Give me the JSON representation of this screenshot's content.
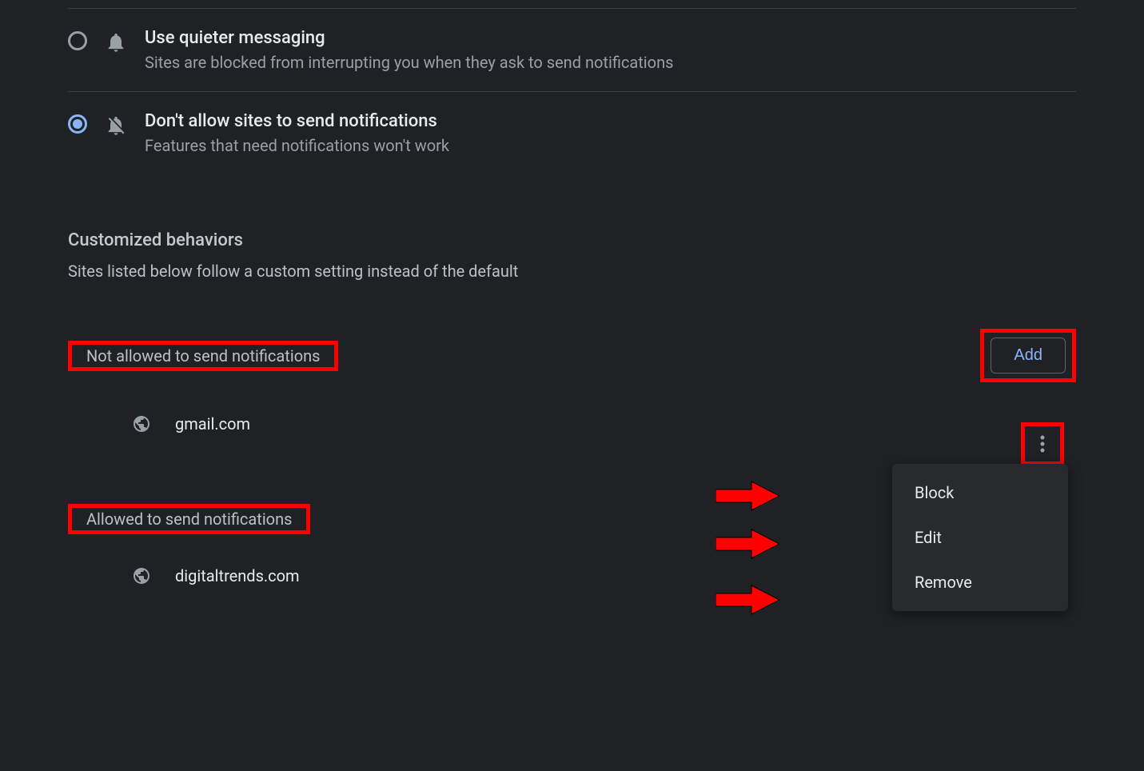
{
  "options": {
    "quieter": {
      "title": "Use quieter messaging",
      "subtitle": "Sites are blocked from interrupting you when they ask to send notifications",
      "selected": false
    },
    "block": {
      "title": "Don't allow sites to send notifications",
      "subtitle": "Features that need notifications won't work",
      "selected": true
    }
  },
  "customized": {
    "heading": "Customized behaviors",
    "description": "Sites listed below follow a custom setting instead of the default"
  },
  "not_allowed": {
    "title": "Not allowed to send notifications",
    "add_label": "Add",
    "sites": [
      {
        "name": "gmail.com"
      }
    ]
  },
  "allowed": {
    "title": "Allowed to send notifications",
    "sites": [
      {
        "name": "digitaltrends.com"
      }
    ]
  },
  "menu": {
    "block": "Block",
    "edit": "Edit",
    "remove": "Remove"
  }
}
